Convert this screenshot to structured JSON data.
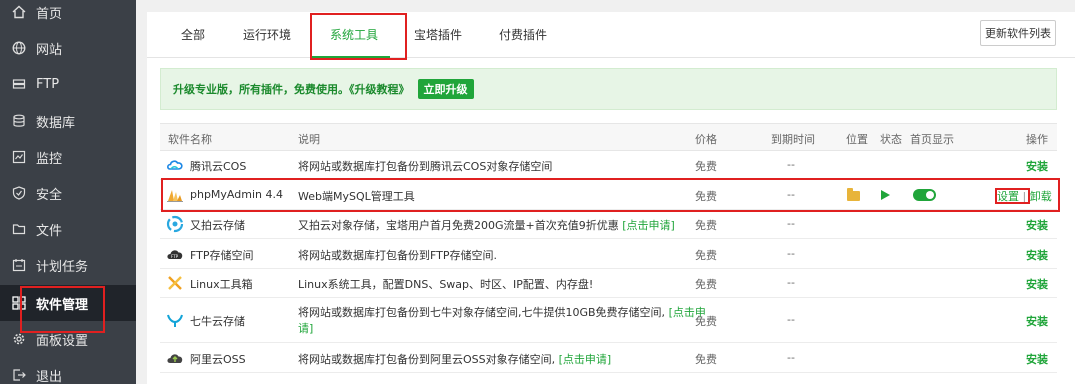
{
  "sidebar": {
    "items": [
      {
        "label": "首页",
        "icon": "home-icon"
      },
      {
        "label": "网站",
        "icon": "globe-icon"
      },
      {
        "label": "FTP",
        "icon": "ftp-icon"
      },
      {
        "label": "数据库",
        "icon": "database-icon"
      },
      {
        "label": "监控",
        "icon": "monitor-icon"
      },
      {
        "label": "安全",
        "icon": "shield-icon"
      },
      {
        "label": "文件",
        "icon": "folder-icon"
      },
      {
        "label": "计划任务",
        "icon": "calendar-icon"
      },
      {
        "label": "软件管理",
        "icon": "grid-icon",
        "active": true
      },
      {
        "label": "面板设置",
        "icon": "gear-icon"
      },
      {
        "label": "退出",
        "icon": "logout-icon"
      }
    ]
  },
  "tabs": [
    "全部",
    "运行环境",
    "系统工具",
    "宝塔插件",
    "付费插件"
  ],
  "active_tab": "系统工具",
  "refresh_button": "更新软件列表",
  "notice": {
    "text": "升级专业版，所有插件，免费使用。",
    "link": "《升级教程》",
    "button": "立即升级"
  },
  "table": {
    "headers": {
      "name": "软件名称",
      "desc": "说明",
      "price": "价格",
      "expire": "到期时间",
      "position": "位置",
      "status": "状态",
      "home": "首页显示",
      "op": "操作"
    },
    "rows": [
      {
        "name": "腾讯云COS",
        "icon": "cloud-cos-icon",
        "desc": "将网站或数据库打包备份到腾讯云COS对象存储空间",
        "desc_link": "",
        "price": "免费",
        "expire": "--",
        "op": "安装"
      },
      {
        "name": "phpMyAdmin 4.4",
        "icon": "phpmyadmin-icon",
        "desc": "Web端MySQL管理工具",
        "desc_link": "",
        "price": "免费",
        "expire": "--",
        "installed": true,
        "home_display": true,
        "op_settings": "设置",
        "op_sep": "|",
        "op_uninstall": "卸载"
      },
      {
        "name": "又拍云存储",
        "icon": "upyun-icon",
        "desc": "又拍云对象存储，宝塔用户首月免费200G流量+首次充值9折优惠",
        "desc_link": "[点击申请]",
        "price": "免费",
        "expire": "--",
        "op": "安装"
      },
      {
        "name": "FTP存储空间",
        "icon": "ftp-storage-icon",
        "desc": "将网站或数据库打包备份到FTP存储空间.",
        "desc_link": "",
        "price": "免费",
        "expire": "--",
        "op": "安装"
      },
      {
        "name": "Linux工具箱",
        "icon": "toolbox-icon",
        "desc": "Linux系统工具，配置DNS、Swap、时区、IP配置、内存盘!",
        "desc_link": "",
        "price": "免费",
        "expire": "--",
        "op": "安装"
      },
      {
        "name": "七牛云存储",
        "icon": "qiniu-icon",
        "desc": "将网站或数据库打包备份到七牛对象存储空间,七牛提供10GB免费存储空间,",
        "desc_link": "[点击申",
        "desc_link2": "请]",
        "price": "免费",
        "expire": "--",
        "op": "安装"
      },
      {
        "name": "阿里云OSS",
        "icon": "aliyun-oss-icon",
        "desc": "将网站或数据库打包备份到阿里云OSS对象存储空间,",
        "desc_link": "[点击申请]",
        "price": "免费",
        "expire": "--",
        "op": "安装"
      }
    ]
  },
  "colors": {
    "accent": "#20a53a",
    "sidebar_bg": "#3b4047",
    "highlight": "#e02020"
  }
}
